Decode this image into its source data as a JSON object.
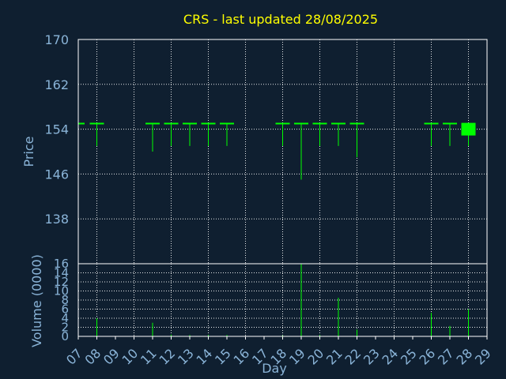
{
  "chart_data": [
    {
      "type": "candlestick",
      "title": "CRS - last updated 28/08/2025",
      "ylabel": "Price",
      "ylim": [
        130,
        170
      ],
      "yticks": [
        138,
        146,
        154,
        162,
        170
      ],
      "x_domain": [
        7,
        29
      ],
      "days": [
        8,
        11,
        12,
        13,
        14,
        15,
        18,
        19,
        20,
        21,
        22,
        26,
        27,
        28
      ],
      "open": [
        155,
        155,
        155,
        155,
        155,
        155,
        155,
        155,
        155,
        155,
        155,
        155,
        155,
        154
      ],
      "high": [
        155,
        155,
        155,
        155,
        155,
        155,
        155,
        155,
        155,
        155,
        155,
        155,
        155,
        155
      ],
      "low": [
        151,
        150,
        151,
        151,
        151,
        151,
        151,
        145,
        151,
        151,
        149,
        151,
        151,
        151
      ],
      "close": [
        155,
        155,
        155,
        155,
        155,
        155,
        155,
        155,
        155,
        155,
        155,
        155,
        155,
        154
      ],
      "up_color": "#00ff00",
      "last_marker_color": "#00ff00"
    },
    {
      "type": "bar",
      "ylabel": "Volume (0000)",
      "xlabel": "Day",
      "ylim": [
        0,
        16
      ],
      "yticks": [
        0,
        2,
        4,
        6,
        8,
        10,
        12,
        14,
        16
      ],
      "x_ticks": [
        "07",
        "08",
        "09",
        "10",
        "11",
        "12",
        "13",
        "14",
        "15",
        "16",
        "17",
        "18",
        "19",
        "20",
        "21",
        "22",
        "23",
        "24",
        "25",
        "26",
        "27",
        "28",
        "29"
      ],
      "days": [
        8,
        11,
        12,
        13,
        14,
        15,
        18,
        19,
        20,
        21,
        22,
        26,
        27,
        28
      ],
      "values": [
        4,
        3,
        0.4,
        0.3,
        0.3,
        0.3,
        0.2,
        16,
        0.3,
        8.5,
        1.5,
        5.2,
        2.3,
        6
      ],
      "color": "#00ff00"
    }
  ]
}
